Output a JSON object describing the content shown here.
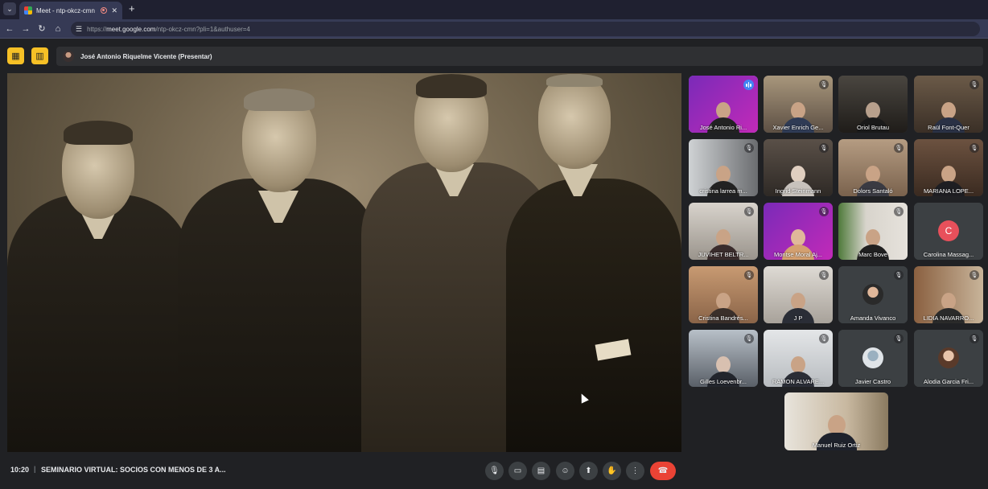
{
  "browser": {
    "tab_title": "Meet - ntp-okcz-cmn",
    "url_prefix": "https://",
    "url_host": "meet.google.com",
    "url_path": "/ntp-okcz-cmn?pli=1&authuser=4"
  },
  "presenter": {
    "name": "José Antonio Riquelme Vicente (Presentar)"
  },
  "participants": [
    {
      "name": "José Antonio Ri...",
      "speaking": true
    },
    {
      "name": "Xavier Enrich Ge..."
    },
    {
      "name": "Oriol Brutau"
    },
    {
      "name": "Raül Font-Quer"
    },
    {
      "name": "cristina larrea m..."
    },
    {
      "name": "Ingrid Steinmann"
    },
    {
      "name": "Dolors Santaló"
    },
    {
      "name": "MARIANA LOPE..."
    },
    {
      "name": "JUVIHET BELTR..."
    },
    {
      "name": "Montse Moral Aj..."
    },
    {
      "name": "Marc Bove"
    },
    {
      "name": "Carolina Massag...",
      "initial": "C"
    },
    {
      "name": "Cristina Bandrés..."
    },
    {
      "name": "J P"
    },
    {
      "name": "Amanda Vivanco"
    },
    {
      "name": "LIDIA NAVARRO..."
    },
    {
      "name": "Gilles Loevenbr..."
    },
    {
      "name": "RAMON ALVARE..."
    },
    {
      "name": "Javier Castro"
    },
    {
      "name": "Alodia Garcia Fri..."
    },
    {
      "name": "Manuel Ruiz Ortiz"
    }
  ],
  "meeting": {
    "time": "10:20",
    "separator": "|",
    "title": "SEMINARIO VIRTUAL: SOCIOS CON MENOS DE 3 A..."
  },
  "icons": {
    "mic": "mic-icon",
    "camera": "camera-icon",
    "captions": "captions-icon",
    "emoji": "emoji-icon",
    "present": "present-icon",
    "hand": "raise-hand-icon",
    "more": "more-icon",
    "end": "end-call-icon"
  },
  "colors": {
    "end_call": "#ea4335",
    "presenter_btn": "#f6c026",
    "speaking_outline": "#8ab4f8"
  }
}
